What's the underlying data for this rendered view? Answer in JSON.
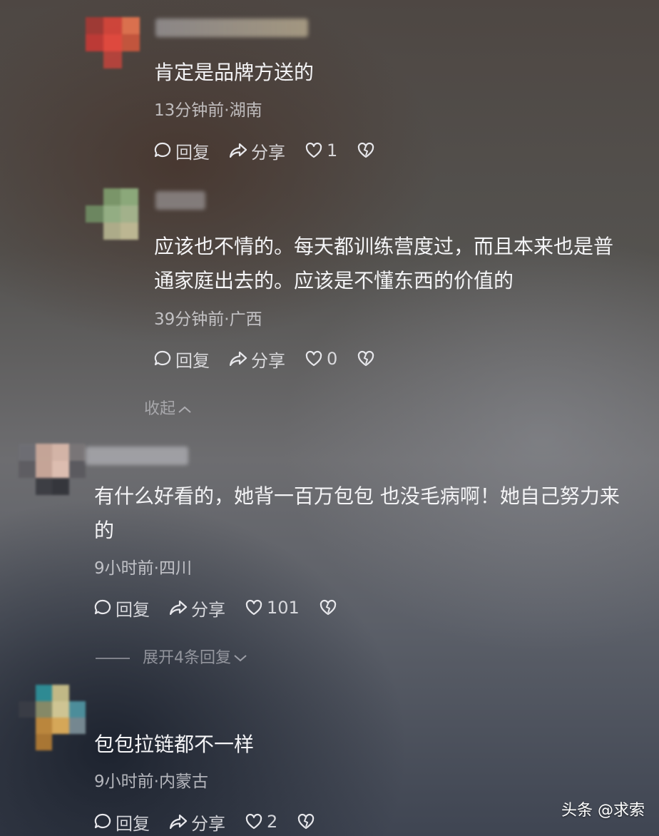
{
  "comments": [
    {
      "text_lines": [
        "肯定是品牌方送的"
      ],
      "meta": "13分钟前·湖南",
      "actions": {
        "reply": "回复",
        "share": "分享",
        "likes": "1"
      }
    },
    {
      "text_lines": [
        "应该也不情的。每天都训练营度过，而且本来也是普",
        "通家庭出去的。应该是不懂东西的价值的"
      ],
      "meta": "39分钟前·广西",
      "actions": {
        "reply": "回复",
        "share": "分享",
        "likes": "0"
      }
    },
    {
      "text_lines": [
        "有什么好看的，她背一百万包包 也没毛病啊！她自己努力来",
        "的"
      ],
      "meta": "9小时前·四川",
      "actions": {
        "reply": "回复",
        "share": "分享",
        "likes": "101"
      }
    },
    {
      "text_lines": [
        "包包拉链都不一样"
      ],
      "meta": "9小时前·内蒙古",
      "actions": {
        "reply": "回复",
        "share": "分享",
        "likes": "2"
      }
    }
  ],
  "collapse_label": "收起",
  "expand_label": "展开4条回复",
  "watermark": "头条 @求索",
  "icons": [
    "reply-icon",
    "share-icon",
    "like-icon",
    "dislike-icon",
    "chevron-up-icon",
    "chevron-down-icon"
  ]
}
